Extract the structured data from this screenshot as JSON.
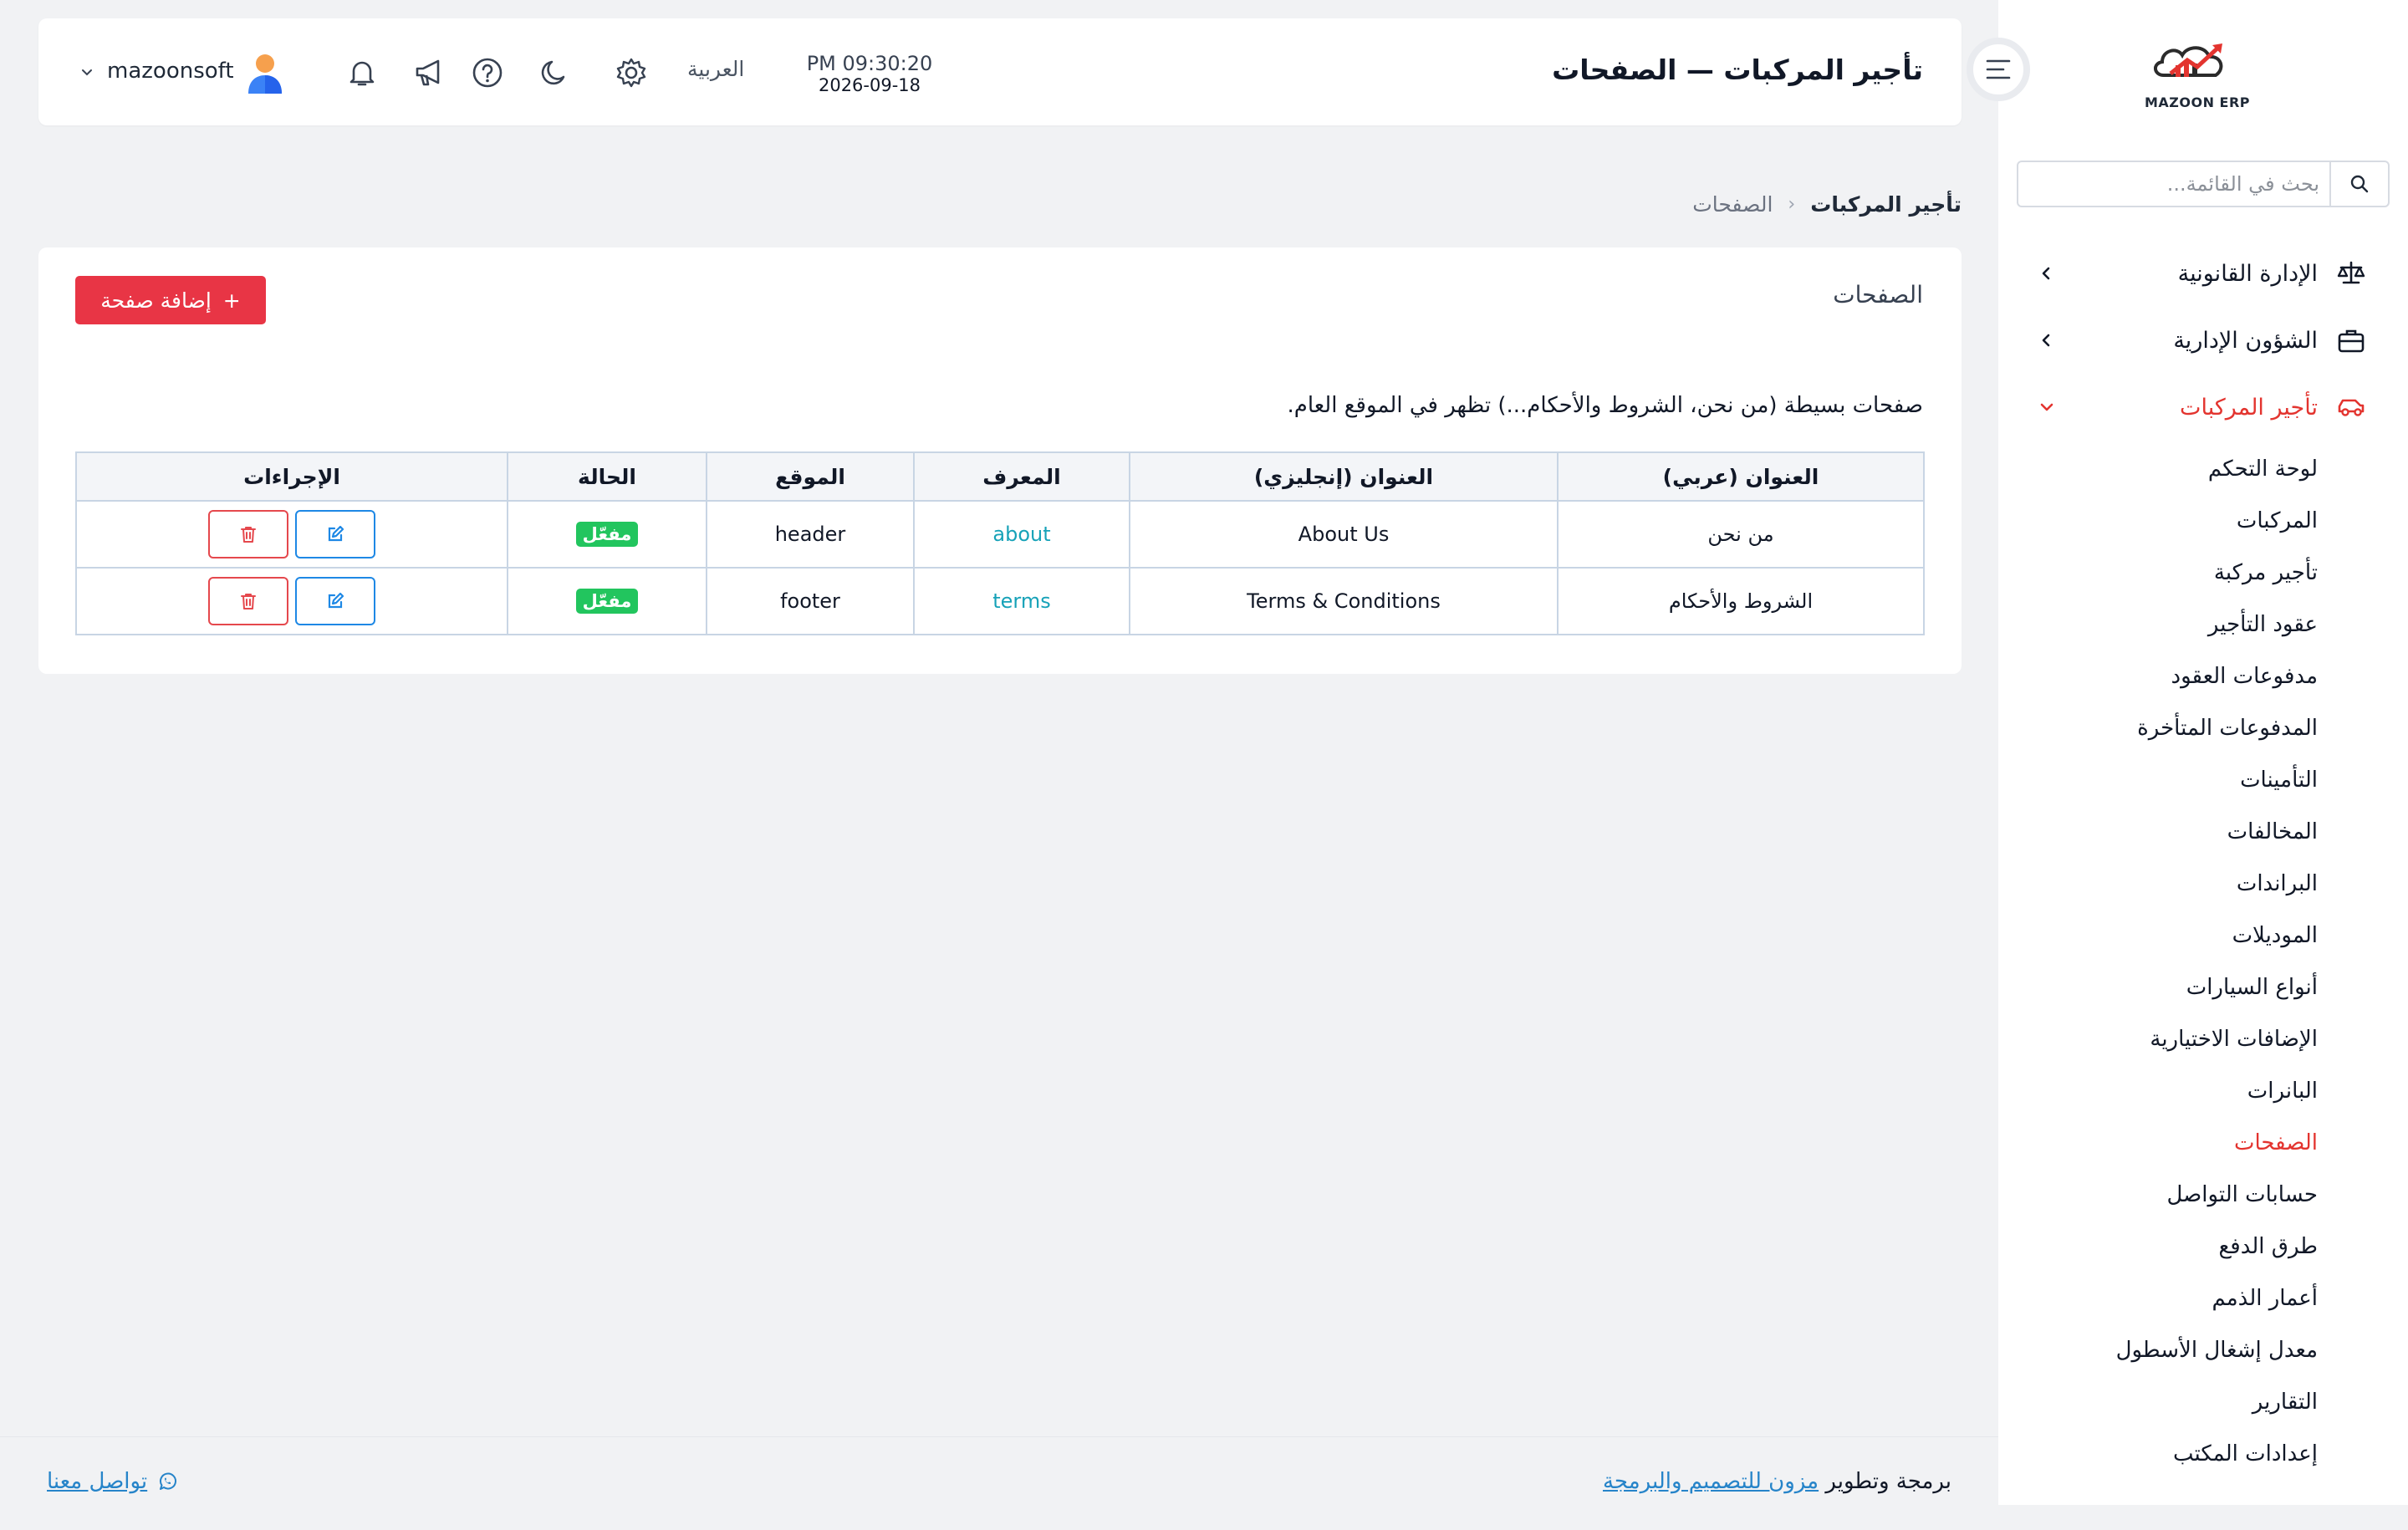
{
  "app": {
    "logo_text": "MAZOON ERP",
    "accent_color": "#e3342f",
    "link_color": "#2684c9"
  },
  "header": {
    "title": "تأجير المركبات — الصفحات",
    "time": "PM 09:30:20",
    "date": "2026-09-18",
    "language": "العربية",
    "user_name": "mazoonsoft",
    "icons": [
      "settings-icon",
      "moon-icon",
      "help-icon",
      "megaphone-icon",
      "bell-icon"
    ]
  },
  "sidebar": {
    "search_placeholder": "بحث في القائمة...",
    "groups": [
      {
        "label": "الإدارة القانونية",
        "icon": "scales-icon",
        "expanded": false
      },
      {
        "label": "الشؤون الإدارية",
        "icon": "briefcase-icon",
        "expanded": false
      },
      {
        "label": "تأجير المركبات",
        "icon": "car-icon",
        "expanded": true
      }
    ],
    "items": [
      {
        "label": "لوحة التحكم"
      },
      {
        "label": "المركبات"
      },
      {
        "label": "تأجير مركبة"
      },
      {
        "label": "عقود التأجير"
      },
      {
        "label": "مدفوعات العقود"
      },
      {
        "label": "المدفوعات المتأخرة"
      },
      {
        "label": "التأمينات"
      },
      {
        "label": "المخالفات"
      },
      {
        "label": "البراندات"
      },
      {
        "label": "الموديلات"
      },
      {
        "label": "أنواع السيارات"
      },
      {
        "label": "الإضافات الاختيارية"
      },
      {
        "label": "البانرات"
      },
      {
        "label": "الصفحات",
        "active": true
      },
      {
        "label": "حسابات التواصل"
      },
      {
        "label": "طرق الدفع"
      },
      {
        "label": "أعمار الذمم"
      },
      {
        "label": "معدل إشغال الأسطول"
      },
      {
        "label": "التقارير"
      },
      {
        "label": "إعدادات المكتب"
      }
    ]
  },
  "breadcrumb": {
    "root": "تأجير المركبات",
    "separator": "‹",
    "current": "الصفحات"
  },
  "main": {
    "card_title": "الصفحات",
    "add_button_label": "إضافة صفحة",
    "add_button_icon": "+",
    "description": "صفحات بسيطة (من نحن، الشروط والأحكام...) تظهر في الموقع العام.",
    "table": {
      "headers": [
        "العنوان (عربي)",
        "العنوان (إنجليزي)",
        "المعرف",
        "الموقع",
        "الحالة",
        "الإجراءات"
      ],
      "rows": [
        {
          "title_ar": "من نحن",
          "title_en": "About Us",
          "slug": "about",
          "position": "header",
          "status": "مفعّل"
        },
        {
          "title_ar": "الشروط والأحكام",
          "title_en": "Terms & Conditions",
          "slug": "terms",
          "position": "footer",
          "status": "مفعّل"
        }
      ]
    }
  },
  "footer": {
    "credit_prefix": "برمجة وتطوير",
    "company": "مزون للتصميم والبرمجة",
    "contact_label": "تواصل معنا"
  }
}
